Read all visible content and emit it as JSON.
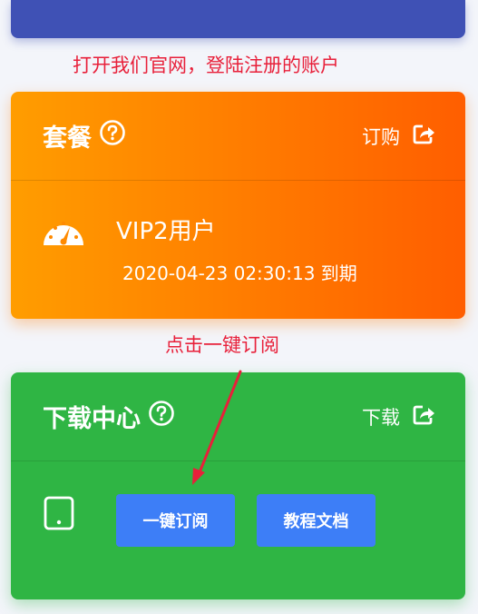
{
  "annotation_top": "打开我们官网，登陆注册的账户",
  "annotation_mid": "点击一键订阅",
  "plan_card": {
    "title": "套餐",
    "action_label": "订购",
    "plan_name": "VIP2用户",
    "expiry": "2020-04-23 02:30:13 到期"
  },
  "download_card": {
    "title": "下载中心",
    "action_label": "下载",
    "subscribe_button": "一键订阅",
    "docs_button": "教程文档"
  },
  "colors": {
    "top_bar": "#3f51b5",
    "plan_card": "#ff7a00",
    "download_card": "#2fb544",
    "button": "#3d7ef7",
    "annotation": "#e8203a"
  },
  "icons": [
    "help-icon",
    "share-icon",
    "gauge-icon",
    "tablet-icon"
  ]
}
